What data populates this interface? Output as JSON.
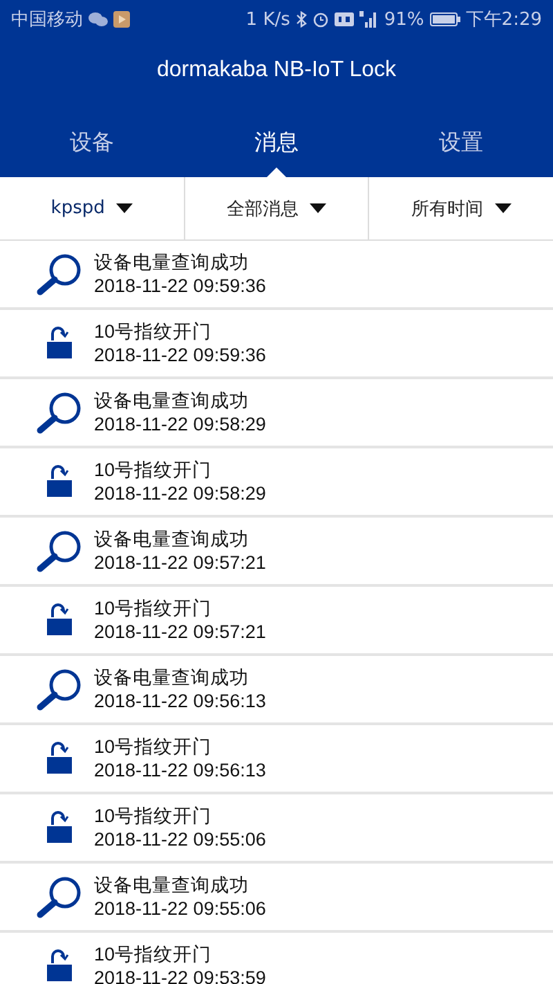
{
  "status_bar": {
    "carrier": "中国移动",
    "speed": "1 K/s",
    "battery": "91%",
    "time": "下午2:29"
  },
  "window": {
    "title": "dormakaba NB-IoT Lock"
  },
  "tabs": [
    {
      "label": "设备",
      "selected": false
    },
    {
      "label": "消息",
      "selected": true
    },
    {
      "label": "设置",
      "selected": false
    }
  ],
  "filters": [
    {
      "label": "kpspd",
      "accent": true
    },
    {
      "label": "全部消息",
      "accent": false
    },
    {
      "label": "所有时间",
      "accent": false
    }
  ],
  "messages": [
    {
      "kind": "query",
      "title": "设备电量查询成功",
      "time": "2018-11-22 09:59:36"
    },
    {
      "kind": "unlock",
      "title": "10号指纹开门",
      "time": "2018-11-22 09:59:36"
    },
    {
      "kind": "query",
      "title": "设备电量查询成功",
      "time": "2018-11-22 09:58:29"
    },
    {
      "kind": "unlock",
      "title": "10号指纹开门",
      "time": "2018-11-22 09:58:29"
    },
    {
      "kind": "query",
      "title": "设备电量查询成功",
      "time": "2018-11-22 09:57:21"
    },
    {
      "kind": "unlock",
      "title": "10号指纹开门",
      "time": "2018-11-22 09:57:21"
    },
    {
      "kind": "query",
      "title": "设备电量查询成功",
      "time": "2018-11-22 09:56:13"
    },
    {
      "kind": "unlock",
      "title": "10号指纹开门",
      "time": "2018-11-22 09:56:13"
    },
    {
      "kind": "unlock",
      "title": "10号指纹开门",
      "time": "2018-11-22 09:55:06"
    },
    {
      "kind": "query",
      "title": "设备电量查询成功",
      "time": "2018-11-22 09:55:06"
    },
    {
      "kind": "unlock",
      "title": "10号指纹开门",
      "time": "2018-11-22 09:53:59"
    }
  ]
}
